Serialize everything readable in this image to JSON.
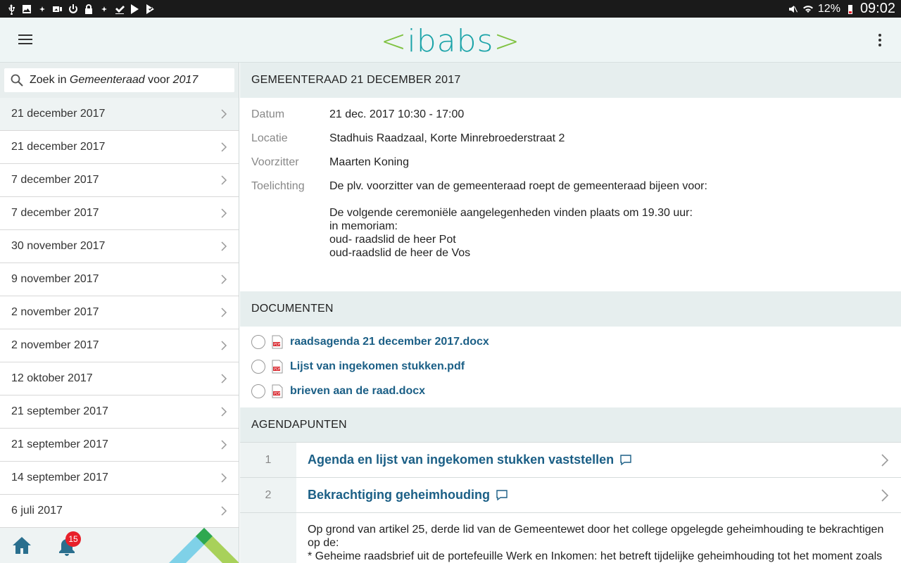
{
  "statusbar": {
    "battery": "12%",
    "time": "09:02"
  },
  "appbar": {
    "logo": "ibabs",
    "logo_open": "<",
    "logo_close": ">"
  },
  "search": {
    "prefix": "Zoek in ",
    "body": "Gemeenteraad",
    "mid": " voor ",
    "year": "2017"
  },
  "dates": [
    "21 december 2017",
    "21 december 2017",
    "7 december 2017",
    "7 december 2017",
    "30 november 2017",
    "9 november 2017",
    "2 november 2017",
    "2 november 2017",
    "12 oktober 2017",
    "21 september 2017",
    "21 september 2017",
    "14 september 2017",
    "6 juli 2017"
  ],
  "footer": {
    "badge": "15"
  },
  "meeting": {
    "header": "GEMEENTERAAD 21 DECEMBER 2017",
    "datum_label": "Datum",
    "datum": "21 dec. 2017 10:30 - 17:00",
    "locatie_label": "Locatie",
    "locatie": "Stadhuis Raadzaal, Korte Minrebroederstraat 2",
    "voorzitter_label": "Voorzitter",
    "voorzitter": "Maarten Koning",
    "toelichting_label": "Toelichting",
    "toelichting_1": "De plv. voorzitter van de gemeenteraad roept de gemeenteraad bijeen voor:",
    "toelichting_2": "De volgende ceremoniële aangelegenheden vinden plaats om 19.30 uur:\nin memoriam:\noud- raadslid de heer Pot\noud-raadslid de heer de Vos"
  },
  "documents": {
    "header": "DOCUMENTEN",
    "items": [
      "raadsagenda 21 december 2017.docx",
      "Lijst van ingekomen stukken.pdf",
      "brieven aan de raad.docx"
    ]
  },
  "agenda": {
    "header": "AGENDAPUNTEN",
    "items": [
      {
        "num": "1",
        "title": "Agenda en lijst van ingekomen stukken vaststellen"
      },
      {
        "num": "2",
        "title": "Bekrachtiging geheimhouding"
      }
    ],
    "item2_text": "Op grond van artikel 25, derde lid van de Gemeentewet door het college opgelegde geheimhouding te bekrachtigen op de:\n* Geheime raadsbrief uit de portefeuille Werk en Inkomen: het betreft tijdelijke geheimhouding tot het moment zoals"
  }
}
